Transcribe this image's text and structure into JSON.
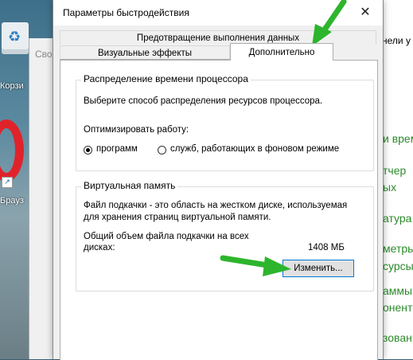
{
  "dialog": {
    "title": "Параметры быстродействия",
    "close_glyph": "✕",
    "tabs": {
      "data_execution": "Предотвращение выполнения данных",
      "visual_effects": "Визуальные эффекты",
      "advanced": "Дополнительно"
    },
    "processor": {
      "legend": "Распределение времени процессора",
      "description": "Выберите способ распределения ресурсов процессора.",
      "optimize_label": "Оптимизировать работу:",
      "option_programs": "программ",
      "option_services": "служб, работающих в фоновом режиме",
      "selected": "programs"
    },
    "virtual_memory": {
      "legend": "Виртуальная память",
      "description_line1": "Файл подкачки - это область на жестком диске, используемая",
      "description_line2": "для хранения страниц виртуальной памяти.",
      "total_label_line1": "Общий объем файла подкачки на всех",
      "total_label_line2": "дисках:",
      "total_value": "1408 МБ",
      "change_button": "Изменить..."
    }
  },
  "background": {
    "back_window_title": "Свой",
    "desktop_labels": {
      "recycle": "Корзи",
      "browser": "Брауз"
    },
    "right_window": {
      "top_text": "нели у",
      "links": [
        "и врем",
        "тчер",
        "ых",
        "атура",
        "метры",
        "сурсы",
        "аммы",
        "онент",
        "зование"
      ]
    }
  },
  "colors": {
    "arrow": "#2db52d",
    "focus_border": "#0078d7",
    "link_green": "#2b8a2b"
  }
}
